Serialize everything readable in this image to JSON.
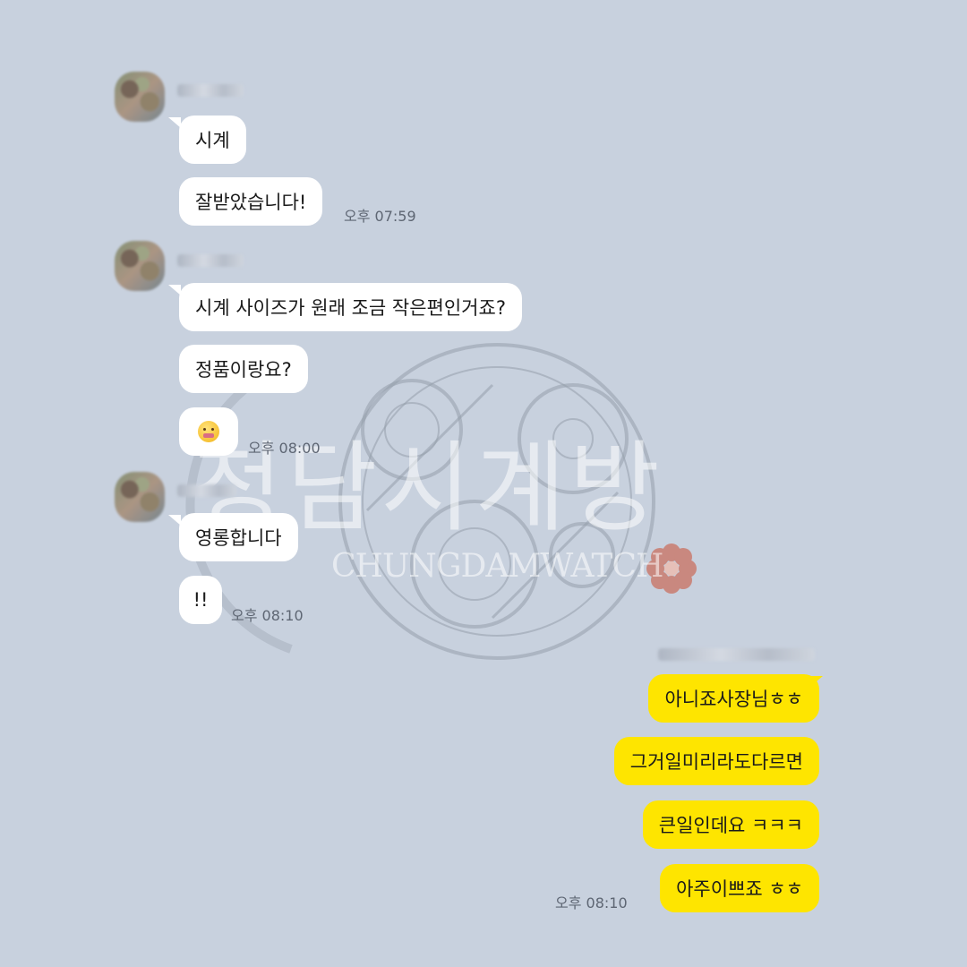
{
  "watermark": {
    "korean": "청담시계방",
    "english": "CHUNGDAMWATCH"
  },
  "groups": [
    {
      "messages": [
        {
          "text": "시계"
        },
        {
          "text": "잘받았습니다!"
        }
      ],
      "time": "오후 07:59"
    },
    {
      "messages": [
        {
          "text": "시계 사이즈가 원래 조금 작은편인거죠?"
        },
        {
          "text": "정품이랑요?"
        },
        {
          "icon": "smiling-face-emoji-icon"
        }
      ],
      "time": "오후 08:00"
    },
    {
      "messages": [
        {
          "text": "영롱합니다"
        },
        {
          "text": "!!"
        }
      ],
      "time": "오후 08:10"
    }
  ],
  "my_messages": {
    "messages": [
      {
        "text": "아니죠사장님ㅎㅎ"
      },
      {
        "text": "그거일미리라도다르면"
      },
      {
        "text": "큰일인데요 ㅋㅋㅋ"
      },
      {
        "text": "아주이쁘죠 ㅎㅎ"
      }
    ],
    "time": "오후 08:10"
  },
  "colors": {
    "background": "#c8d1de",
    "incoming_bubble": "#ffffff",
    "outgoing_bubble": "#fee500",
    "time_text": "#5e6673"
  }
}
